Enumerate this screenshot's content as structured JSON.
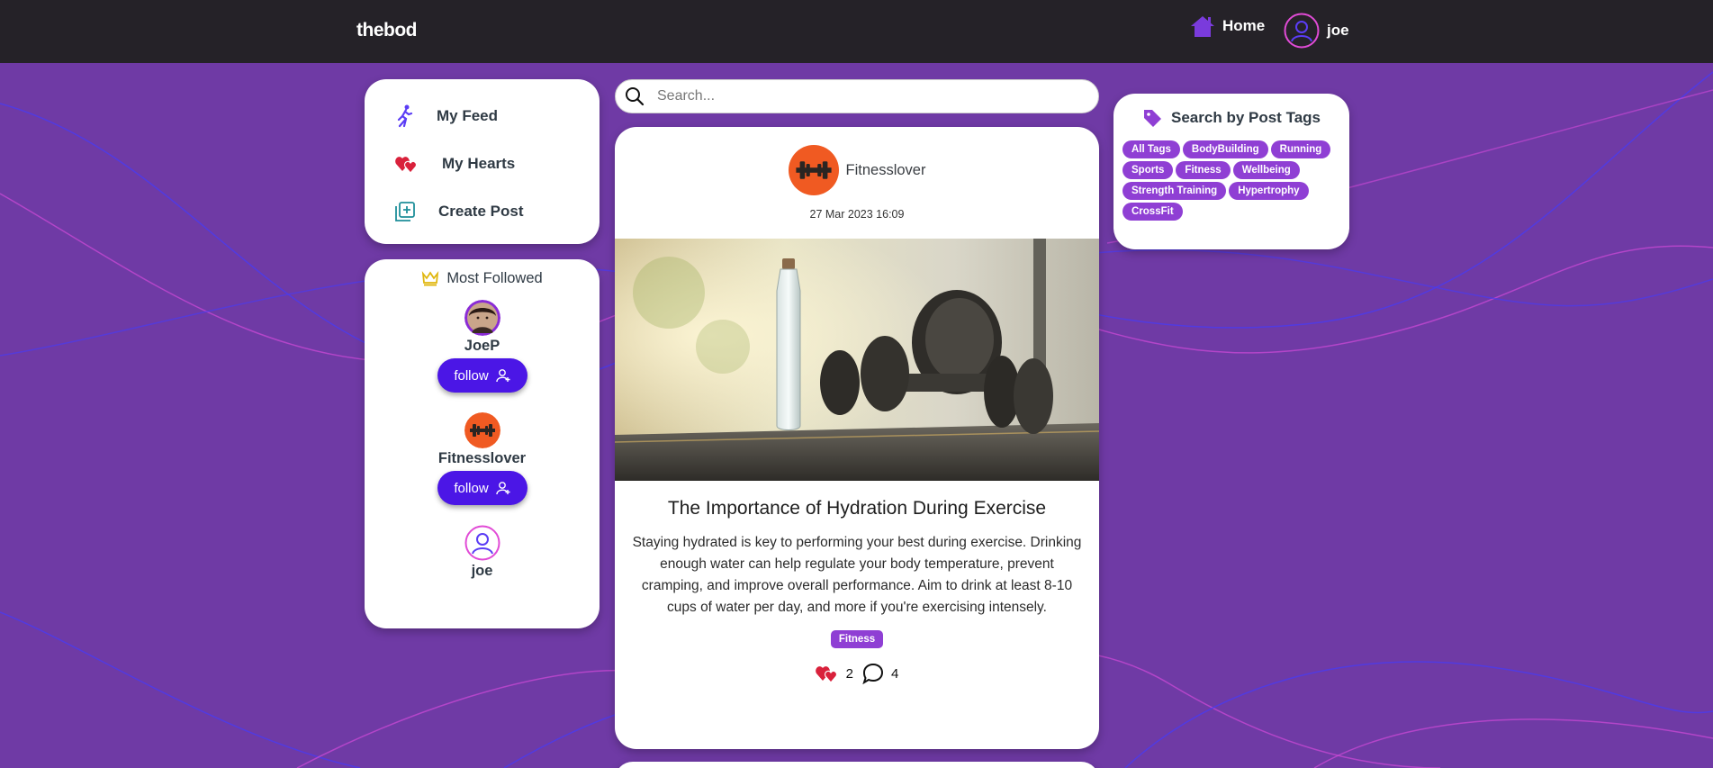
{
  "brand": "thebod",
  "nav": {
    "home_label": "Home",
    "user_name": "joe"
  },
  "menu": {
    "items": [
      {
        "label": "My Feed",
        "icon": "runner-icon"
      },
      {
        "label": "My Hearts",
        "icon": "hearts-icon"
      },
      {
        "label": "Create Post",
        "icon": "add-post-icon"
      }
    ]
  },
  "most_followed": {
    "title": "Most Followed",
    "users": [
      {
        "name": "JoeP",
        "button": "follow"
      },
      {
        "name": "Fitnesslover",
        "button": "follow"
      },
      {
        "name": "joe"
      }
    ]
  },
  "search": {
    "placeholder": "Search..."
  },
  "post": {
    "author": "Fitnesslover",
    "date": "27 Mar 2023 16:09",
    "title": "The Importance of Hydration During Exercise",
    "body": "Staying hydrated is key to performing your best during exercise. Drinking enough water can help regulate your body temperature, prevent cramping, and improve overall performance. Aim to drink at least 8-10 cups of water per day, and more if you're exercising intensely.",
    "tag": "Fitness",
    "hearts": "2",
    "comments": "4"
  },
  "tag_search": {
    "title": "Search by Post Tags",
    "tags": [
      "All Tags",
      "BodyBuilding",
      "Running",
      "Sports",
      "Fitness",
      "Wellbeing",
      "Strength Training",
      "Hypertrophy",
      "CrossFit"
    ]
  },
  "colors": {
    "background": "#6f3aa5",
    "navbar": "#252228",
    "accent_button": "#4b16e6",
    "tag": "#8f3fd4",
    "avatar_orange": "#f05a22"
  }
}
